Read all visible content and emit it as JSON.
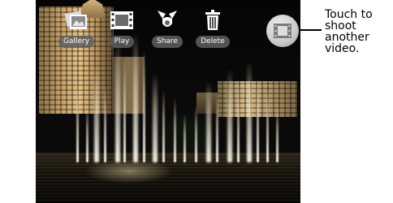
{
  "toolbar": {
    "items": [
      {
        "label": "Gallery",
        "icon": "gallery-icon"
      },
      {
        "label": "Play",
        "icon": "film-icon"
      },
      {
        "label": "Share",
        "icon": "share-icon"
      },
      {
        "label": "Delete",
        "icon": "trash-icon"
      }
    ]
  },
  "camera_button": {
    "icon": "video-camera-icon"
  },
  "callout": {
    "text": "Touch to shoot another video."
  },
  "colors": {
    "label_bg": "#5f5f5f",
    "screen_bg": "#000000",
    "callout_text": "#000000"
  }
}
